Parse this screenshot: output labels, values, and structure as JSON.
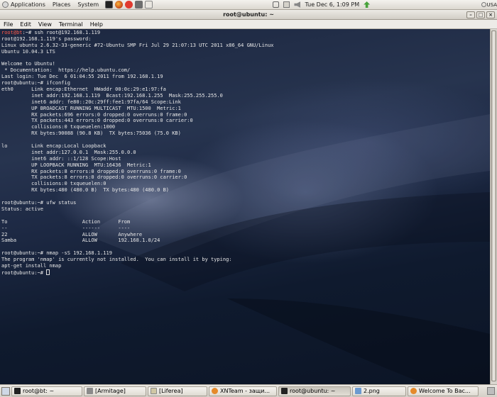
{
  "top_panel": {
    "menus": [
      "Applications",
      "Places",
      "System"
    ],
    "clock": "Tue Dec  6,  1:09 PM",
    "keyboard_layout": "USA",
    "icons": [
      "foot-icon",
      "terminal-icon",
      "firefox-icon",
      "x-icon",
      "tool-icon",
      "document-icon",
      "network-icon",
      "mail-icon",
      "volume-icon",
      "update-icon"
    ]
  },
  "window": {
    "title": "root@ubuntu: ~",
    "menus": [
      "File",
      "Edit",
      "View",
      "Terminal",
      "Help"
    ]
  },
  "terminal": {
    "lines": [
      {
        "prompt": "root@bt",
        "rest": ":~# ssh root@192.168.1.119"
      },
      {
        "text": "root@192.168.1.119's password:"
      },
      {
        "text": "Linux ubuntu 2.6.32-33-generic #72-Ubuntu SMP Fri Jul 29 21:07:13 UTC 2011 x86_64 GNU/Linux"
      },
      {
        "text": "Ubuntu 10.04.3 LTS"
      },
      {
        "text": ""
      },
      {
        "text": "Welcome to Ubuntu!"
      },
      {
        "text": " * Documentation:  https://help.ubuntu.com/"
      },
      {
        "text": "Last login: Tue Dec  6 01:04:55 2011 from 192.168.1.19"
      },
      {
        "text": "root@ubuntu:~# ifconfig"
      },
      {
        "text": "eth0      Link encap:Ethernet  HWaddr 00:0c:29:e1:97:fa"
      },
      {
        "text": "          inet addr:192.168.1.119  Bcast:192.168.1.255  Mask:255.255.255.0"
      },
      {
        "text": "          inet6 addr: fe80::20c:29ff:fee1:97fa/64 Scope:Link"
      },
      {
        "text": "          UP BROADCAST RUNNING MULTICAST  MTU:1500  Metric:1"
      },
      {
        "text": "          RX packets:696 errors:0 dropped:0 overruns:0 frame:0"
      },
      {
        "text": "          TX packets:443 errors:0 dropped:0 overruns:0 carrier:0"
      },
      {
        "text": "          collisions:0 txqueuelen:1000"
      },
      {
        "text": "          RX bytes:90088 (90.8 KB)  TX bytes:75036 (75.0 KB)"
      },
      {
        "text": ""
      },
      {
        "text": "lo        Link encap:Local Loopback"
      },
      {
        "text": "          inet addr:127.0.0.1  Mask:255.0.0.0"
      },
      {
        "text": "          inet6 addr: ::1/128 Scope:Host"
      },
      {
        "text": "          UP LOOPBACK RUNNING  MTU:16436  Metric:1"
      },
      {
        "text": "          RX packets:8 errors:0 dropped:0 overruns:0 frame:0"
      },
      {
        "text": "          TX packets:8 errors:0 dropped:0 overruns:0 carrier:0"
      },
      {
        "text": "          collisions:0 txqueuelen:0"
      },
      {
        "text": "          RX bytes:480 (480.0 B)  TX bytes:480 (480.0 B)"
      },
      {
        "text": ""
      },
      {
        "text": "root@ubuntu:~# ufw status"
      },
      {
        "text": "Status: active"
      },
      {
        "text": ""
      },
      {
        "text": "To                         Action      From"
      },
      {
        "text": "--                         ------      ----"
      },
      {
        "text": "22                         ALLOW       Anywhere"
      },
      {
        "text": "Samba                      ALLOW       192.168.1.0/24"
      },
      {
        "text": ""
      },
      {
        "text": "root@ubuntu:~# nmap -sS 192.168.1.119"
      },
      {
        "text": "The program 'nmap' is currently not installed.  You can install it by typing:"
      },
      {
        "text": "apt-get install nmap"
      },
      {
        "text": "root@ubuntu:~# ",
        "cursor": true
      }
    ]
  },
  "taskbar": {
    "tasks": [
      {
        "label": "root@bt: ~",
        "icon": "terminal-icon",
        "active": false
      },
      {
        "label": "[Armitage]",
        "icon": "armitage-icon",
        "active": false
      },
      {
        "label": "[Liferea]",
        "icon": "liferea-icon",
        "active": false
      },
      {
        "label": "XNTeam - защи...",
        "icon": "firefox-icon",
        "active": false
      },
      {
        "label": "root@ubuntu: ~",
        "icon": "terminal-icon",
        "active": true
      },
      {
        "label": "2.png",
        "icon": "image-icon",
        "active": false
      },
      {
        "label": "Welcome To Bac...",
        "icon": "firefox-icon",
        "active": false
      }
    ]
  }
}
